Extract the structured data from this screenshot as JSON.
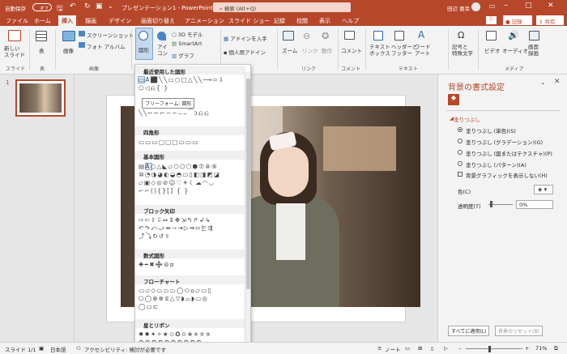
{
  "titlebar": {
    "autosave": "自動保存",
    "autosave_state": "オフ",
    "filename": "プレゼンテーション1 - PowerPoint",
    "search_placeholder": "検索 (Alt+Q)",
    "user": "田辺 喜幸"
  },
  "tabs": [
    "ファイル",
    "ホーム",
    "挿入",
    "描画",
    "デザイン",
    "画面切り替え",
    "アニメーション",
    "スライド ショー",
    "記録",
    "校閲",
    "表示",
    "ヘルプ"
  ],
  "active_tab": "挿入",
  "actions": {
    "record": "記録",
    "share": "共有"
  },
  "ribbon": {
    "new_slide": "新しい\nスライド",
    "table": "表",
    "image": "画像",
    "screenshot": "スクリーンショット",
    "photo_album": "フォト アルバム",
    "shapes": "図形",
    "icons": "アイ\nコン",
    "model3d": "3D モデル",
    "smartart": "SmartArt",
    "graph": "グラフ",
    "addins": "アドインを入手",
    "my_addins": "個人用アドイン",
    "zoom": "ズーム",
    "link": "リンク",
    "action": "動作",
    "comment": "コメント",
    "textbox": "テキスト\nボックス",
    "header_footer": "ヘッダーと\nフッター",
    "wordart": "ワード\nアート",
    "symbol": "記号と\n特殊文字",
    "video": "ビデオ",
    "audio": "オーディオ",
    "screen_recording": "画面\n録画",
    "groups": {
      "slide": "スライド",
      "table": "表",
      "image": "画像",
      "link": "リンク",
      "comment": "コメント",
      "text": "テキスト",
      "media": "メディア"
    }
  },
  "thumbnail": {
    "number": "1"
  },
  "shapes_menu": {
    "recent": "最近使用した図形",
    "recent_rows": [
      "▭A⬛╲╲▭○□△╲╲⟶⇨⇩",
      "⬠◁⎌{ }"
    ],
    "tooltip": "フリーフォーム: 図形",
    "lines_row": "╲╲⌐⌐⌐∽∽⌣⌣⁀ↄ⎌⎌",
    "rectangles": "四角形",
    "rect_row": "▭▭▭▢▢▢▭▭▭",
    "basic": "基本図形",
    "basic_rows": [
      "▤A○△◣▱⬡⬠⬡⬢⑦⑧⑨",
      "⑩◔◑◕◐◒◓▭▯◧◨◩◪",
      "▱▣◇◎⊘☺♡☀☾☁◠◡",
      "⌐⌐(){}[] { }"
    ],
    "block_arrows": "ブロック矢印",
    "block_rows": [
      "⇨⇦⇧⇩⇔⇕✥⇲↰↱↲↳",
      "↶↷⤺⤻⇴⇾⇥▷⇛⇰⬱⇶",
      "⤴⤵↻↺⇪"
    ],
    "equations": "数式図形",
    "eq_row": "✚━✖➗⊜⧄",
    "flowchart": "フローチャート",
    "flow_rows": [
      "▭▱◇▭▭▭◯⬭⌂▱▭▯",
      "⬠◯⊗⊕⧖△▽◗⌓◗▭◎",
      "◯▭⊏"
    ],
    "stars": "星とリボン",
    "star_rows": [
      "✸✹✦✧★✩✪✫✬✭✮✯",
      "⚙⚙⚙⚙⚙⚙⚙⚙⚙⚙"
    ]
  },
  "pane": {
    "title": "背景の書式設定",
    "fill_section": "塗りつぶし",
    "options": [
      "塗りつぶし (単色)(S)",
      "塗りつぶし (グラデーション)(G)",
      "塗りつぶし (図またはテクスチャ)(P)",
      "塗りつぶし (パターン)(A)"
    ],
    "hide_graphics": "背景グラフィックを表示しない(H)",
    "color_label": "色(C)",
    "transparency_label": "透明度(T)",
    "transparency_value": "0%",
    "apply_all": "すべてに適用(L)",
    "reset": "背景のリセット(B)"
  },
  "status": {
    "slide": "スライド 1/1",
    "lang": "日本語",
    "accessibility": "アクセシビリティ: 検討が必要です",
    "notes": "ノート",
    "zoom": "71%"
  },
  "colors": {
    "accent": "#b7472a",
    "selected_shape": "#dde8f5"
  }
}
